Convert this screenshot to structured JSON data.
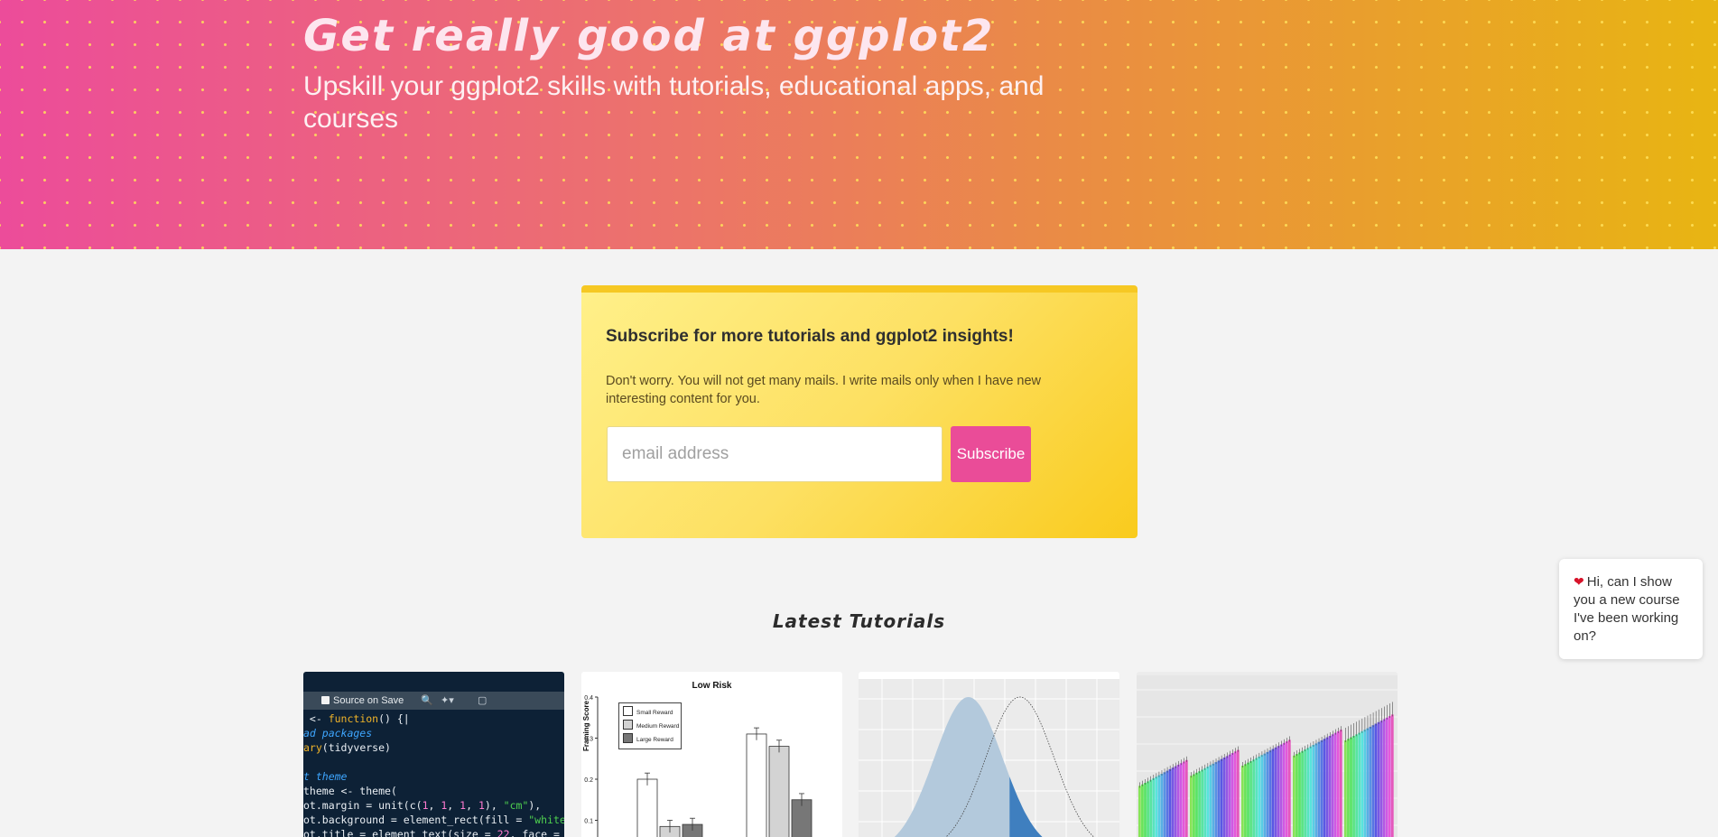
{
  "hero": {
    "title": "Get really good at ggplot2",
    "subtitle": "Upskill your ggplot2 skills with tutorials, educational apps, and courses"
  },
  "subscribe": {
    "title": "Subscribe for more tutorials and ggplot2 insights!",
    "text": "Don't worry. You will not get many mails. I write mails only when I have new interesting content for you.",
    "email_placeholder": "email address",
    "button_label": "Subscribe"
  },
  "latest": {
    "heading": "Latest Tutorials"
  },
  "chat": {
    "message": "Hi, can I show you a new course I've been working on?"
  },
  "tutorials": [
    {
      "thumbnail": "code-editor",
      "toolbar_label": "Source on Save",
      "code_lines": [
        [
          [
            "",
            " <- "
          ],
          [
            "kw",
            "function"
          ],
          [
            "",
            "() {"
          ]
        ],
        [
          [
            "cm",
            "ad packages"
          ]
        ],
        [
          [
            "kw",
            "ary"
          ],
          [
            "",
            "(tidyverse)"
          ]
        ],
        [
          [
            "",
            ""
          ]
        ],
        [
          [
            "cm",
            "t theme"
          ]
        ],
        [
          [
            "",
            "theme <- theme("
          ]
        ],
        [
          [
            "",
            "ot.margin = unit(c("
          ],
          [
            "nu",
            "1"
          ],
          [
            "",
            ", "
          ],
          [
            "nu",
            "1"
          ],
          [
            "",
            ", "
          ],
          [
            "nu",
            "1"
          ],
          [
            "",
            ", "
          ],
          [
            "nu",
            "1"
          ],
          [
            "",
            "), "
          ],
          [
            "st",
            "\"cm\""
          ],
          [
            "",
            "),"
          ]
        ],
        [
          [
            "",
            "ot.background = element_rect(fill = "
          ],
          [
            "st",
            "\"white"
          ]
        ],
        [
          [
            "",
            "ot.title = element_text(size = "
          ],
          [
            "nu",
            "22"
          ],
          [
            "",
            ", face = "
          ]
        ]
      ]
    },
    {
      "thumbnail": "bar-chart",
      "chart_data": {
        "type": "bar",
        "title": "Low Risk",
        "ylabel": "Framing Score",
        "ylim": [
          0,
          0.4
        ],
        "yticks": [
          "0.4",
          "0.3",
          "0.2",
          "0.1"
        ],
        "series": [
          {
            "name": "Small Reward",
            "values": [
              0.2,
              0.31
            ],
            "color": "#ffffff"
          },
          {
            "name": "Medium Reward",
            "values": [
              0.085,
              0.28
            ],
            "color": "#d3d3d3"
          },
          {
            "name": "Large Reward",
            "values": [
              0.09,
              0.15
            ],
            "color": "#777777"
          }
        ]
      }
    },
    {
      "thumbnail": "density-plot",
      "chart_data": {
        "type": "area",
        "series": [
          {
            "mean": 0,
            "sd": 1,
            "style": "filled",
            "color": "#b3c9dc"
          },
          {
            "mean": 1.5,
            "sd": 1,
            "style": "dotted",
            "color": "#444444"
          }
        ],
        "shaded_tail_color": "#3f7fbf"
      }
    },
    {
      "thumbnail": "grouped-bar-chart",
      "chart_data": {
        "type": "bar",
        "groups": 5,
        "bars_per_group": 18,
        "group_base_values": [
          0.62,
          0.66,
          0.7,
          0.74,
          0.8
        ]
      }
    }
  ]
}
